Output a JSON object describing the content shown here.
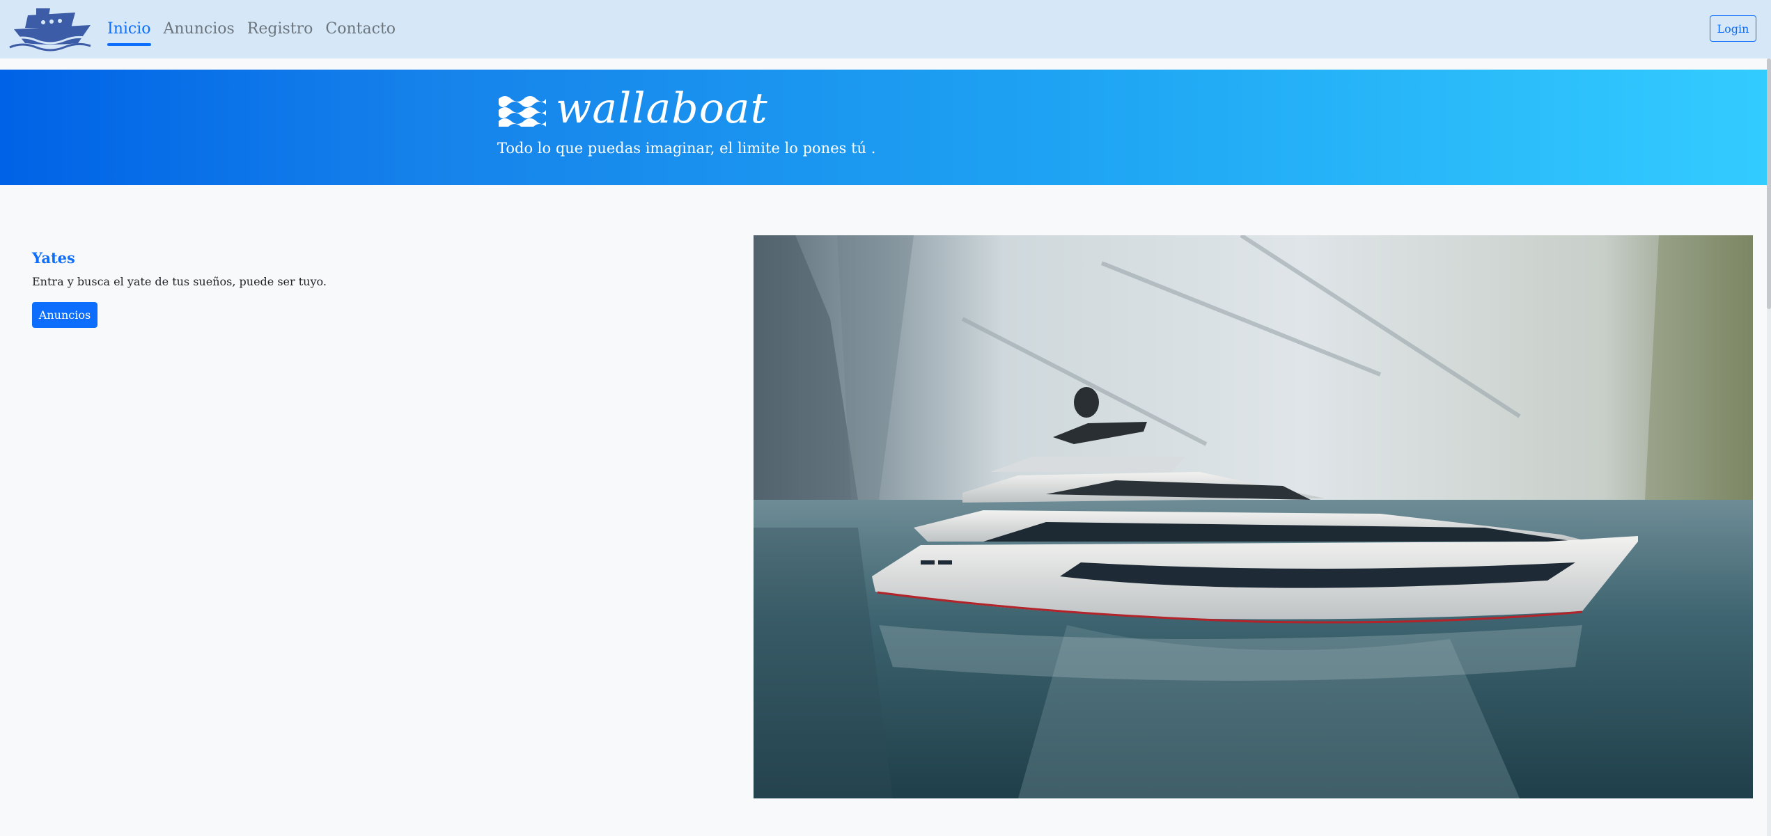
{
  "navbar": {
    "logo_icon": "ship-icon",
    "links": [
      {
        "label": "Inicio",
        "active": true
      },
      {
        "label": "Anuncios",
        "active": false
      },
      {
        "label": "Registro",
        "active": false
      },
      {
        "label": "Contacto",
        "active": false
      }
    ],
    "login_label": "Login"
  },
  "hero": {
    "icon": "waves-icon",
    "title": "wallaboat",
    "subtitle": "Todo lo que puedas imaginar, el limite lo pones tú ."
  },
  "section": {
    "title": "Yates",
    "text": "Entra y busca el yate de tus sueños, puede ser tuyo.",
    "button_label": "Anuncios"
  },
  "photo": {
    "subject": "yacht-photo"
  },
  "colors": {
    "navbar_bg": "#d6e8f7",
    "primary": "#0d6efd",
    "hero_gradient_start": "#0062e6",
    "hero_gradient_end": "#33ccff",
    "page_bg": "#f8f9fa"
  }
}
